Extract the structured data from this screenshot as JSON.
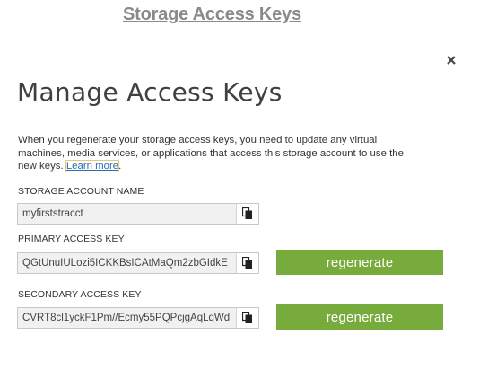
{
  "banner": {
    "title": "Storage Access Keys"
  },
  "dialog": {
    "title": "Manage Access Keys",
    "description": "When you regenerate your storage access keys, you need to update any virtual machines, media services, or applications that access this storage account to use the new keys.",
    "learn_more": "Learn more",
    "description_end": "."
  },
  "account": {
    "label": "STORAGE ACCOUNT NAME",
    "value": "myfirststracct"
  },
  "primary": {
    "label": "PRIMARY ACCESS KEY",
    "value": "QGtUnuIULozi5ICKKBsICAtMaQm2zbGIdkE",
    "regenerate_label": "regenerate"
  },
  "secondary": {
    "label": "SECONDARY ACCESS KEY",
    "value": "CVRT8cl1yckF1Pm//Ecmy55PQPcjgAqLqWd",
    "regenerate_label": "regenerate"
  },
  "icons": {
    "close": "close-icon",
    "copy": "copy-icon"
  },
  "colors": {
    "regenerate": "#77ab3b",
    "link": "#2b6cb0"
  }
}
